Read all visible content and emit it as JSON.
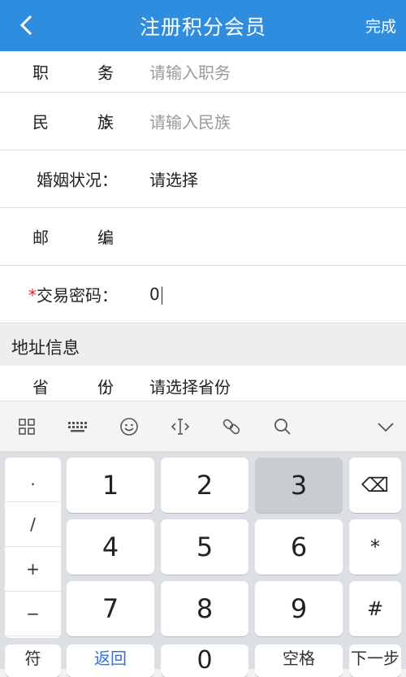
{
  "header": {
    "title": "注册积分会员",
    "done_label": "完成"
  },
  "form": {
    "rows": [
      {
        "label": "职　务",
        "colon": "：",
        "value": "请输入职务",
        "state": "placeholder"
      },
      {
        "label": "民　族",
        "colon": "：",
        "value": "请输入民族",
        "state": "placeholder"
      },
      {
        "label": "婚姻状况",
        "colon": "：",
        "value": "请选择",
        "state": "set"
      },
      {
        "label": "邮　编",
        "colon": "：",
        "value": "",
        "state": "empty"
      },
      {
        "label": "交易密码",
        "required_mark": "*",
        "colon": "：",
        "value": "0",
        "state": "focused"
      }
    ]
  },
  "address_section": {
    "title": "地址信息",
    "rows": [
      {
        "label": "省　份",
        "colon": "：",
        "value": "请选择省份"
      }
    ]
  },
  "keyboard": {
    "toolbar_icons": [
      "apps-grid-icon",
      "keyboard-icon",
      "emoji-icon",
      "cursor-move-icon",
      "link-icon",
      "search-icon",
      "collapse-chevron-icon"
    ],
    "symbols": [
      ".",
      "/",
      "+",
      "−"
    ],
    "digits": [
      "1",
      "2",
      "3",
      "4",
      "5",
      "6",
      "7",
      "8",
      "9"
    ],
    "pressed_key": "3",
    "right_keys": [
      "⌫",
      "*",
      "#"
    ],
    "bottom_row_partial": [
      "符",
      "返回",
      "0",
      "空格",
      "下一步"
    ]
  },
  "colors": {
    "header_bg": "#2f8de0",
    "required_mark": "#e02424",
    "placeholder": "#9a9a9a"
  }
}
